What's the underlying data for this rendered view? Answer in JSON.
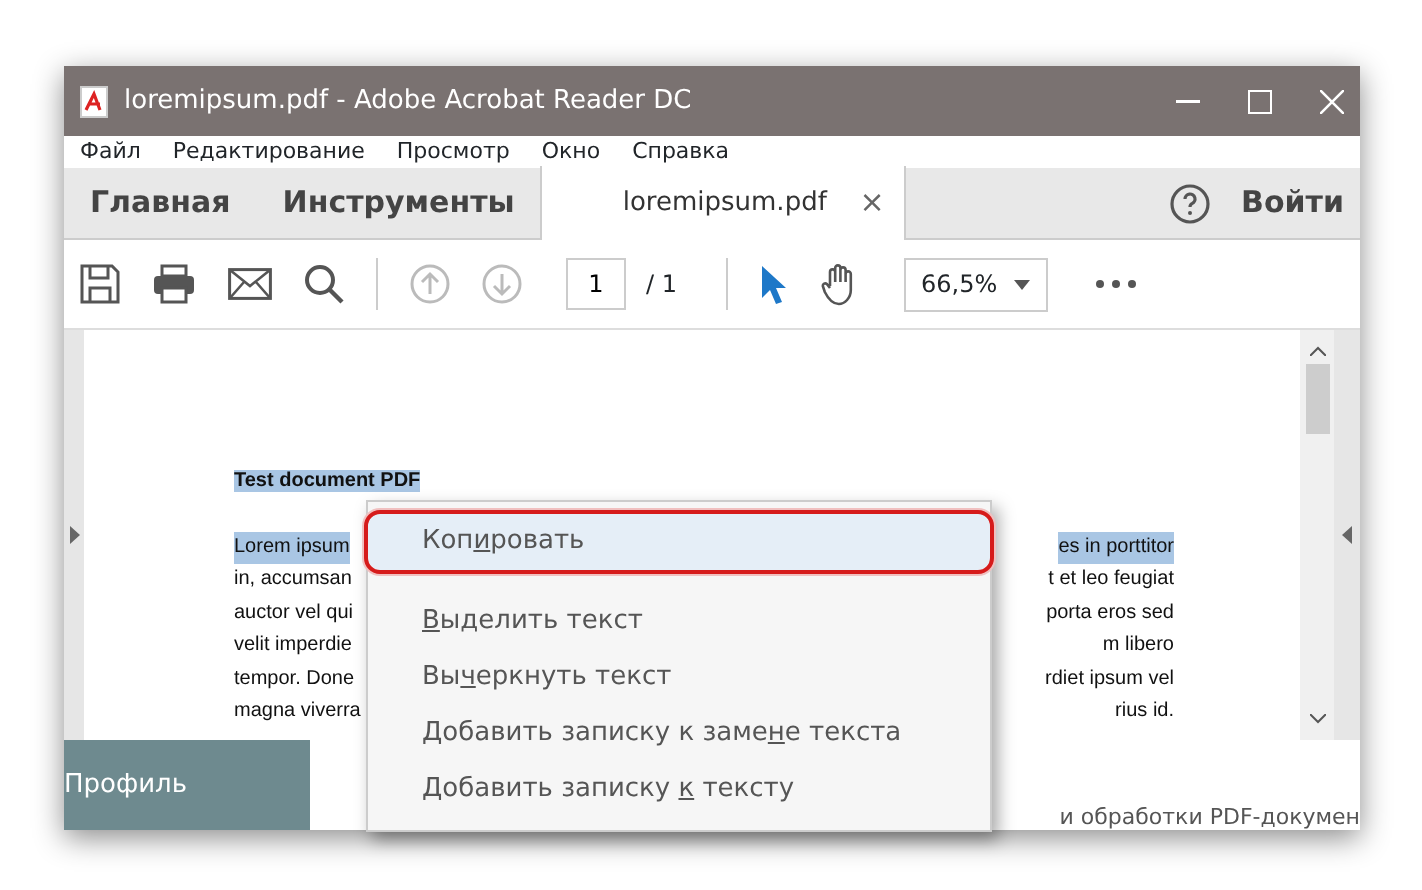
{
  "window": {
    "title": "loremipsum.pdf - Adobe Acrobat Reader DC"
  },
  "menu_bar": [
    "Файл",
    "Редактирование",
    "Просмотр",
    "Окно",
    "Справка"
  ],
  "tabs": [
    {
      "label": "Главная",
      "selected": false
    },
    {
      "label": "Инструменты",
      "selected": false
    },
    {
      "label": "loremipsum.pdf",
      "selected": true,
      "close": "×"
    }
  ],
  "sign_in": "Войти",
  "toolbar": {
    "page": "1",
    "pages": "/ 1",
    "zoom": "66,5%"
  },
  "document": {
    "title": {
      "text": "Test document PDF",
      "selected": true
    },
    "lines": [
      {
        "left": "Lorem ipsum",
        "right": "es in porttitor",
        "selected": true
      },
      {
        "left": "in, accumsan",
        "right": "t et leo feugiat",
        "selected": false
      },
      {
        "left": "auctor vel qui",
        "right": "porta eros sed",
        "selected": false
      },
      {
        "left": "velit imperdie",
        "right": "m libero",
        "selected": false
      },
      {
        "left": "tempor. Done",
        "right": "rdiet ipsum vel",
        "selected": false
      },
      {
        "left": "magna viverra",
        "right": "rius id.",
        "selected": false
      }
    ]
  },
  "background": {
    "profile": "Профиль",
    "text": "и обработки PDF-докумен"
  },
  "context_menu": [
    {
      "before": "Коп",
      "key": "и",
      "after": "ровать",
      "selected": true
    },
    {
      "key": "В",
      "after": "ыделить текст",
      "selected": false
    },
    {
      "before": "Вы",
      "key": "ч",
      "after": "еркнуть текст",
      "selected": false
    },
    {
      "before": "Добавить записку к заме",
      "key": "н",
      "after": "е текста",
      "selected": false
    },
    {
      "before": "Добавить записку ",
      "key": "к",
      "after": " тексту",
      "selected": false
    }
  ]
}
